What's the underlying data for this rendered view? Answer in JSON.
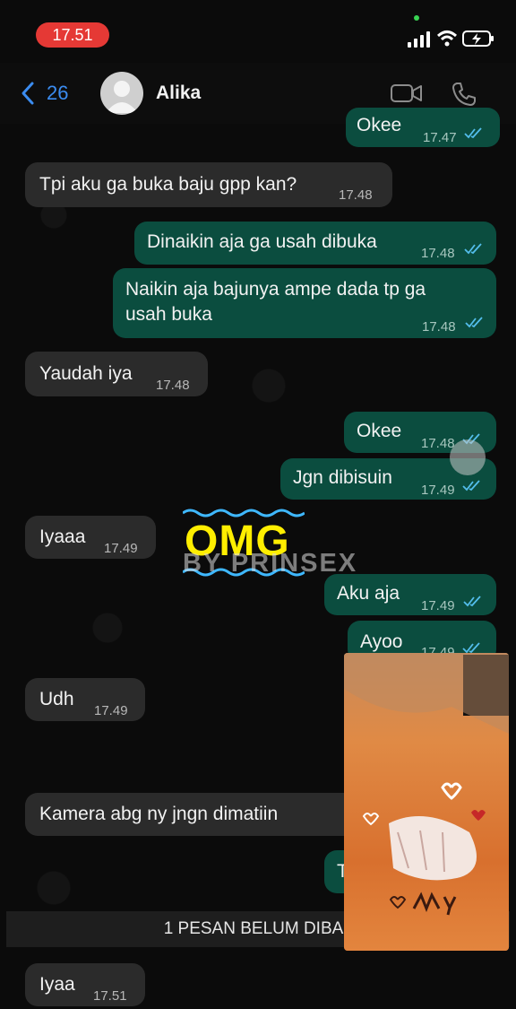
{
  "status_bar": {
    "time": "17.51"
  },
  "header": {
    "back_count": "26",
    "contact_name": "Alika"
  },
  "messages": [
    {
      "text": "Okee",
      "time": "17.47"
    },
    {
      "text": "Tpi aku ga buka baju gpp kan?",
      "time": "17.48"
    },
    {
      "text": "Dinaikin aja ga usah dibuka",
      "time": "17.48"
    },
    {
      "text_line1": "Naikin aja bajunya ampe dada tp ga",
      "text_line2": "usah buka",
      "time": "17.48"
    },
    {
      "text": "Yaudah iya",
      "time": "17.48"
    },
    {
      "text": "Okee",
      "time": "17.48"
    },
    {
      "text": "Jgn dibisuin",
      "time": "17.49"
    },
    {
      "text": "Iyaaa",
      "time": "17.49"
    },
    {
      "text": "Aku aja",
      "time": "17.49"
    },
    {
      "text": "Ayoo",
      "time": "17.49"
    },
    {
      "text": "Udh",
      "time": "17.49"
    },
    {
      "text": "Kamera abg ny jngn dimatiin"
    },
    {
      "text": "T"
    },
    {
      "text": "Iyaa",
      "time": "17.51"
    }
  ],
  "overlay": {
    "omg": "OMG",
    "watermark": "BY PRINSEX"
  },
  "unread_banner": "1 PESAN BELUM DIBA",
  "colors": {
    "incoming": "#2b2b2b",
    "outgoing": "#0b4d3f",
    "accent": "#3b8cf0",
    "time_pill": "#e53935",
    "omg": "#ffee00"
  }
}
